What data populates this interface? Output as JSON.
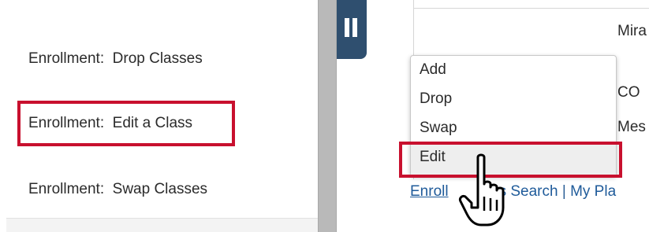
{
  "left_panel": {
    "items": [
      {
        "label": "Enrollment:  Drop Classes"
      },
      {
        "label": "Enrollment:  Edit a Class"
      },
      {
        "label": "Enrollment:  Swap Classes"
      }
    ],
    "highlighted_index": 1
  },
  "splitter": {
    "icon": "pause-icon"
  },
  "right_panel": {
    "partial_texts": {
      "row1": "Mira",
      "row2": "CO",
      "row3": "Mes"
    },
    "menu": {
      "items": [
        {
          "label": "Add"
        },
        {
          "label": "Drop"
        },
        {
          "label": "Swap"
        },
        {
          "label": "Edit"
        }
      ],
      "highlighted": "Edit"
    },
    "links": {
      "enroll_visible": "Enroll",
      "search_visible": "s Search",
      "separator": " | ",
      "plan_visible": "My Pla"
    }
  },
  "colors": {
    "highlight_border": "#c8102e",
    "splitter_tab": "#2f4f6f",
    "link": "#1f5b9a"
  },
  "cursor": {
    "icon": "hand-pointer-icon"
  }
}
